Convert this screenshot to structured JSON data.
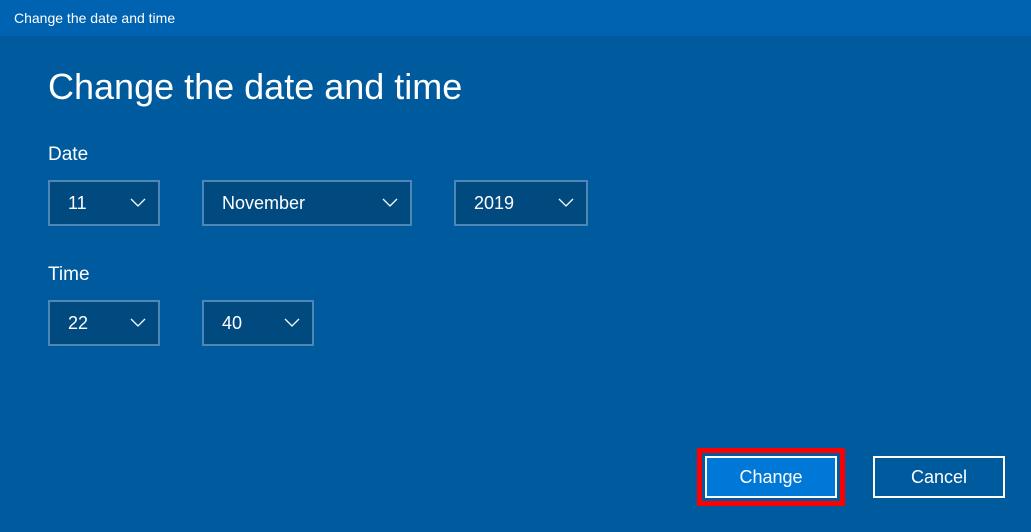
{
  "titlebar": {
    "text": "Change the date and time"
  },
  "heading": "Change the date and time",
  "labels": {
    "date": "Date",
    "time": "Time"
  },
  "date": {
    "day": "11",
    "month": "November",
    "year": "2019"
  },
  "time": {
    "hour": "22",
    "minute": "40"
  },
  "buttons": {
    "change": "Change",
    "cancel": "Cancel"
  }
}
